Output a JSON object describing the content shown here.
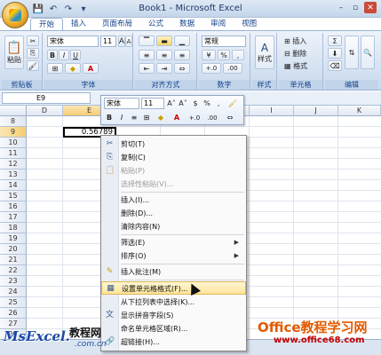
{
  "window": {
    "title": "Book1 - Microsoft Excel",
    "minimize": "–",
    "restore": "▫",
    "close": "✕"
  },
  "qat": [
    "💾",
    "↶",
    "↷",
    "▾"
  ],
  "tabs": [
    "开始",
    "插入",
    "页面布局",
    "公式",
    "数据",
    "审阅",
    "视图"
  ],
  "ribbon": {
    "clipboard": {
      "paste": "粘贴",
      "label": "剪贴板"
    },
    "font": {
      "name": "宋体",
      "size": "11",
      "grow": "A",
      "shrink": "A",
      "bold": "B",
      "italic": "I",
      "underline": "U",
      "label": "字体"
    },
    "alignment": {
      "label": "对齐方式"
    },
    "number": {
      "format": "常规",
      "percent": "%",
      "comma": ",",
      "label": "数字"
    },
    "styles": {
      "label": "样式",
      "btn": "样式"
    },
    "cells": {
      "insert": "插入",
      "delete": "删除",
      "format": "格式",
      "label": "单元格"
    },
    "editing": {
      "label": "编辑",
      "sum": "Σ"
    }
  },
  "formula_bar": {
    "name_box": "E9"
  },
  "columns": [
    "D",
    "E",
    "F",
    "G",
    "H",
    "I",
    "J",
    "K"
  ],
  "rows": [
    "8",
    "9",
    "10",
    "11",
    "12",
    "13",
    "14",
    "15",
    "16",
    "17",
    "18",
    "19",
    "20",
    "21",
    "22",
    "23",
    "24",
    "25",
    "26",
    "27",
    "28"
  ],
  "cell": {
    "E9": "0.56789"
  },
  "mini_toolbar": {
    "font": "宋体",
    "size": "11",
    "grow": "A˄",
    "shrink": "A˅",
    "currency": "$",
    "percent": "%",
    "comma": ",",
    "bold": "B",
    "italic": "I",
    "fontcolor": "A",
    "inc": "+.0",
    "dec": ".00"
  },
  "menu": [
    {
      "label": "剪切(T)",
      "icon": "✂"
    },
    {
      "label": "复制(C)",
      "icon": "⎘"
    },
    {
      "label": "粘贴(P)",
      "icon": "📋",
      "disabled": true
    },
    {
      "label": "选择性粘贴(V)...",
      "disabled": true
    },
    {
      "label": "插入(I)..."
    },
    {
      "label": "删除(D)..."
    },
    {
      "label": "清除内容(N)"
    },
    {
      "label": "筛选(E)",
      "submenu": true
    },
    {
      "label": "排序(O)",
      "submenu": true
    },
    {
      "label": "插入批注(M)",
      "icon": "✎"
    },
    {
      "label": "设置单元格格式(F)...",
      "icon": "▦",
      "highlight": true
    },
    {
      "label": "从下拉列表中选择(K)..."
    },
    {
      "label": "显示拼音字段(S)",
      "icon": "文"
    },
    {
      "label": "命名单元格区域(R)..."
    },
    {
      "label": "超链接(H)...",
      "icon": "🔗"
    }
  ],
  "submenu_arrow": "▶",
  "watermark": {
    "left": "MsExcel.",
    "left2": "教程网",
    "left3": ".com.cn",
    "right": "Office教程学习网",
    "right2": "www.office68.com"
  }
}
